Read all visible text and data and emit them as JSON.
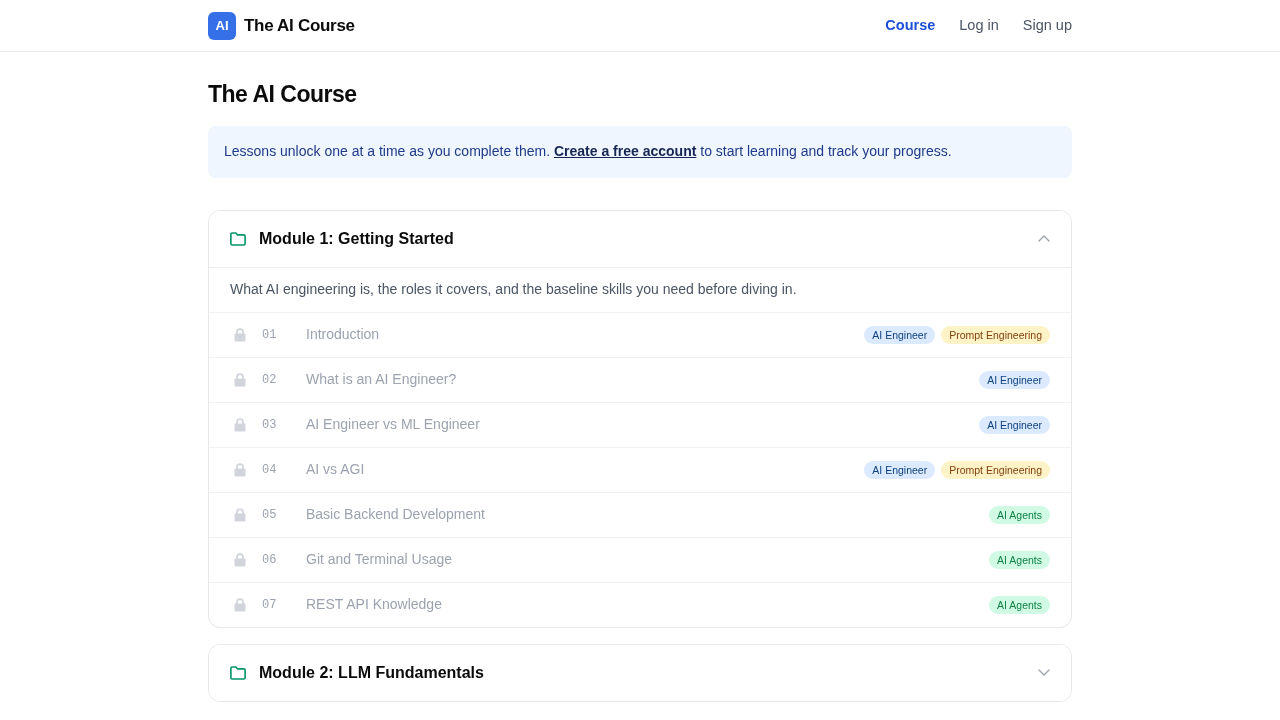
{
  "header": {
    "logo_mark": "AI",
    "brand": "The AI Course",
    "nav": [
      {
        "label": "Course",
        "selected": true
      },
      {
        "label": "Log in",
        "selected": false
      },
      {
        "label": "Sign up",
        "selected": false
      }
    ]
  },
  "page_title": "The AI Course",
  "notice": {
    "before": "Lessons unlock one at a time as you complete them.",
    "link": "Create a free account",
    "after": "to start learning and track your progress."
  },
  "modules": [
    {
      "title": "Module 1: Getting Started",
      "expanded": true,
      "description": "What AI engineering is, the roles it covers, and the baseline skills you need before diving in.",
      "lessons": [
        {
          "number": "01",
          "title": "Introduction",
          "locked": true,
          "tags": [
            {
              "label": "AI Engineer",
              "color": "#dbeafe"
            },
            {
              "label": "Prompt Engineering",
              "color": "#fef3c7"
            }
          ]
        },
        {
          "number": "02",
          "title": "What is an AI Engineer?",
          "locked": true,
          "tags": [
            {
              "label": "AI Engineer",
              "color": "#dbeafe"
            }
          ]
        },
        {
          "number": "03",
          "title": "AI Engineer vs ML Engineer",
          "locked": true,
          "tags": [
            {
              "label": "AI Engineer",
              "color": "#dbeafe"
            }
          ]
        },
        {
          "number": "04",
          "title": "AI vs AGI",
          "locked": true,
          "tags": [
            {
              "label": "AI Engineer",
              "color": "#dbeafe"
            },
            {
              "label": "Prompt Engineering",
              "color": "#fef3c7"
            }
          ]
        },
        {
          "number": "05",
          "title": "Basic Backend Development",
          "locked": true,
          "tags": [
            {
              "label": "AI Agents",
              "color": "#d1fae5"
            }
          ]
        },
        {
          "number": "06",
          "title": "Git and Terminal Usage",
          "locked": true,
          "tags": [
            {
              "label": "AI Agents",
              "color": "#d1fae5"
            }
          ]
        },
        {
          "number": "07",
          "title": "REST API Knowledge",
          "locked": true,
          "tags": [
            {
              "label": "AI Agents",
              "color": "#d1fae5"
            }
          ]
        }
      ]
    },
    {
      "title": "Module 2: LLM Fundamentals",
      "expanded": false
    }
  ]
}
